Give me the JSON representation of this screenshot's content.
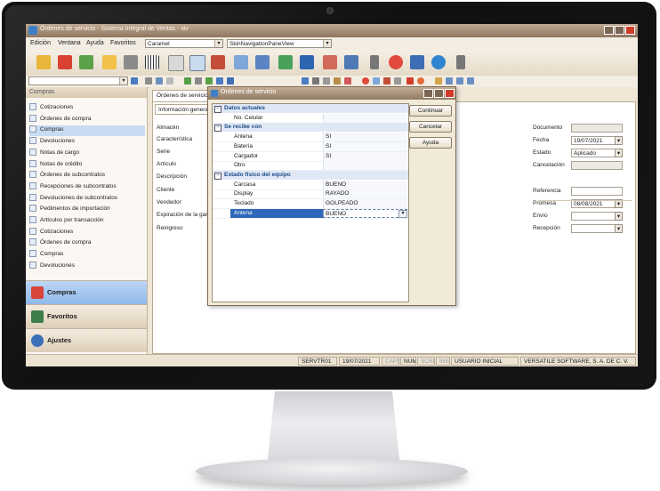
{
  "window": {
    "title": "Órdenes de servicio - Sistema Integral de Ventas - siv"
  },
  "menu": {
    "items": [
      "Edición",
      "Ventana",
      "Ayuda",
      "Favoritos"
    ],
    "skin_value": "Caramel",
    "view_value": "SkinNavigationPaneView"
  },
  "left_pane": {
    "header": "Compras",
    "items": [
      "Cotizaciones",
      "Órdenes de compra",
      "Compras",
      "Devoluciones",
      "Notas de cargo",
      "Notas de crédito",
      "Órdenes de subcontratos",
      "Recepciones de subcontratos",
      "Devoluciones de subcontratos",
      "Pedimentos de importación",
      "Artículos por transacción",
      "Cotizaciones",
      "Órdenes de compra",
      "Compras",
      "Devoluciones"
    ],
    "selected_index": 2,
    "groups": [
      "Compras",
      "Favoritos",
      "Ajustes"
    ]
  },
  "document": {
    "tab": "Órdenes de servicio",
    "subtab": "Información general",
    "left_labels": [
      "Almacén",
      "Característica",
      "Serie",
      "Artículo",
      "Descripción",
      "Cliente",
      "Vendedor",
      "Expiración de la garantía",
      "Reingreso"
    ],
    "right_fields": [
      {
        "label": "Documento",
        "value": ""
      },
      {
        "label": "Fecha",
        "value": "19/07/2021"
      },
      {
        "label": "Estado",
        "value": "Aplicado"
      },
      {
        "label": "Cancelación",
        "value": ""
      },
      {
        "label": "Referencia",
        "value": ""
      },
      {
        "label": "Promesa",
        "value": "08/08/2021"
      },
      {
        "label": "Envío",
        "value": ""
      },
      {
        "label": "Recepción",
        "value": ""
      }
    ]
  },
  "dialog": {
    "title": "Órdenes de servicio",
    "sections": [
      {
        "title": "Datos actuales",
        "rows": [
          {
            "label": "No. Celular",
            "value": ""
          }
        ]
      },
      {
        "title": "Se recibe con",
        "rows": [
          {
            "label": "Antena",
            "value": "SI"
          },
          {
            "label": "Batería",
            "value": "SI"
          },
          {
            "label": "Cargador",
            "value": "SI"
          },
          {
            "label": "Otro",
            "value": ""
          }
        ]
      },
      {
        "title": "Estado físico del equipo",
        "rows": [
          {
            "label": "Carcasa",
            "value": "BUENO"
          },
          {
            "label": "Display",
            "value": "RAYADO"
          },
          {
            "label": "Teclado",
            "value": "GOLPEADO"
          },
          {
            "label": "Antena",
            "value": "BUENO"
          }
        ]
      }
    ],
    "buttons": {
      "continue": "Continuar",
      "cancel": "Cancelar",
      "help": "Ayuda"
    }
  },
  "status_bar": {
    "server": "SERVTR01",
    "date": "19/07/2021",
    "caps": "CAPS",
    "num": "NUM",
    "scrl": "SCRL",
    "ins": "INS",
    "user": "USUARIO INICIAL",
    "company": "VERSATILE SOFTWARE, S. A. DE C. V."
  },
  "colors": {
    "accent": "#2f68b8",
    "titlebar": "#9c8470",
    "close": "#d23a2a",
    "section_text": "#1f4a8a"
  }
}
